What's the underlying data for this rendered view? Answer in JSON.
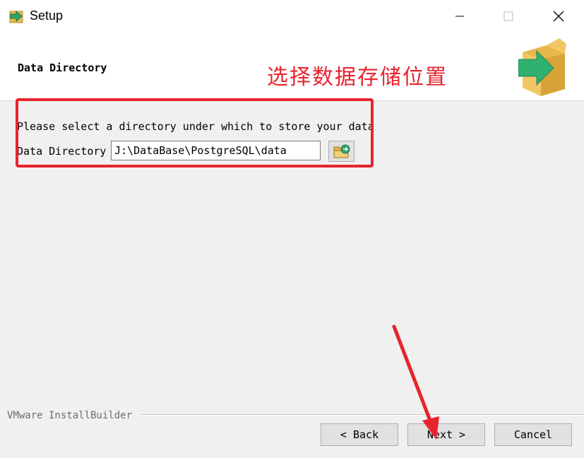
{
  "window": {
    "title": "Setup",
    "minimize_icon": "minimize-icon",
    "maximize_icon": "maximize-icon",
    "close_icon": "close-icon"
  },
  "header": {
    "title": "Data Directory",
    "annotation": "选择数据存储位置",
    "annotation_color": "#e8242e",
    "logo_icon": "installer-box-icon"
  },
  "main": {
    "prompt": "Please select a directory under which to store your data",
    "directory_label": "Data Directory",
    "directory_value": "J:\\DataBase\\PostgreSQL\\data",
    "browse_icon": "folder-browse-icon"
  },
  "footer": {
    "brand": "VMware InstallBuilder",
    "back_label": "< Back",
    "next_label": "Next >",
    "cancel_label": "Cancel"
  },
  "accent_color": "#e8242e"
}
